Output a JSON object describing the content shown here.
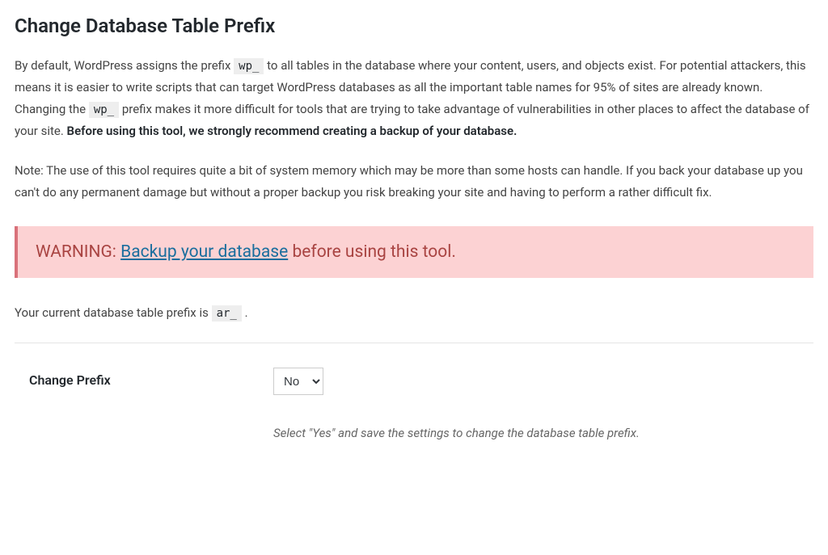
{
  "title": "Change Database Table Prefix",
  "intro": {
    "part1": "By default, WordPress assigns the prefix ",
    "code1": "wp_",
    "part2": " to all tables in the database where your content, users, and objects exist. For potential attackers, this means it is easier to write scripts that can target WordPress databases as all the important table names for 95% of sites are already known. Changing the ",
    "code2": "wp_",
    "part3": " prefix makes it more difficult for tools that are trying to take advantage of vulnerabilities in other places to affect the database of your site. ",
    "strong": "Before using this tool, we strongly recommend creating a backup of your database."
  },
  "note": "Note: The use of this tool requires quite a bit of system memory which may be more than some hosts can handle. If you back your database up you can't do any permanent damage but without a proper backup you risk breaking your site and having to perform a rather difficult fix.",
  "warning": {
    "prefix": "WARNING: ",
    "link_text": "Backup your database",
    "suffix": " before using this tool."
  },
  "current_prefix": {
    "label": "Your current database table prefix is ",
    "value": "ar_",
    "suffix": " ."
  },
  "form": {
    "label": "Change Prefix",
    "select_value": "No",
    "description": "Select \"Yes\" and save the settings to change the database table prefix."
  }
}
